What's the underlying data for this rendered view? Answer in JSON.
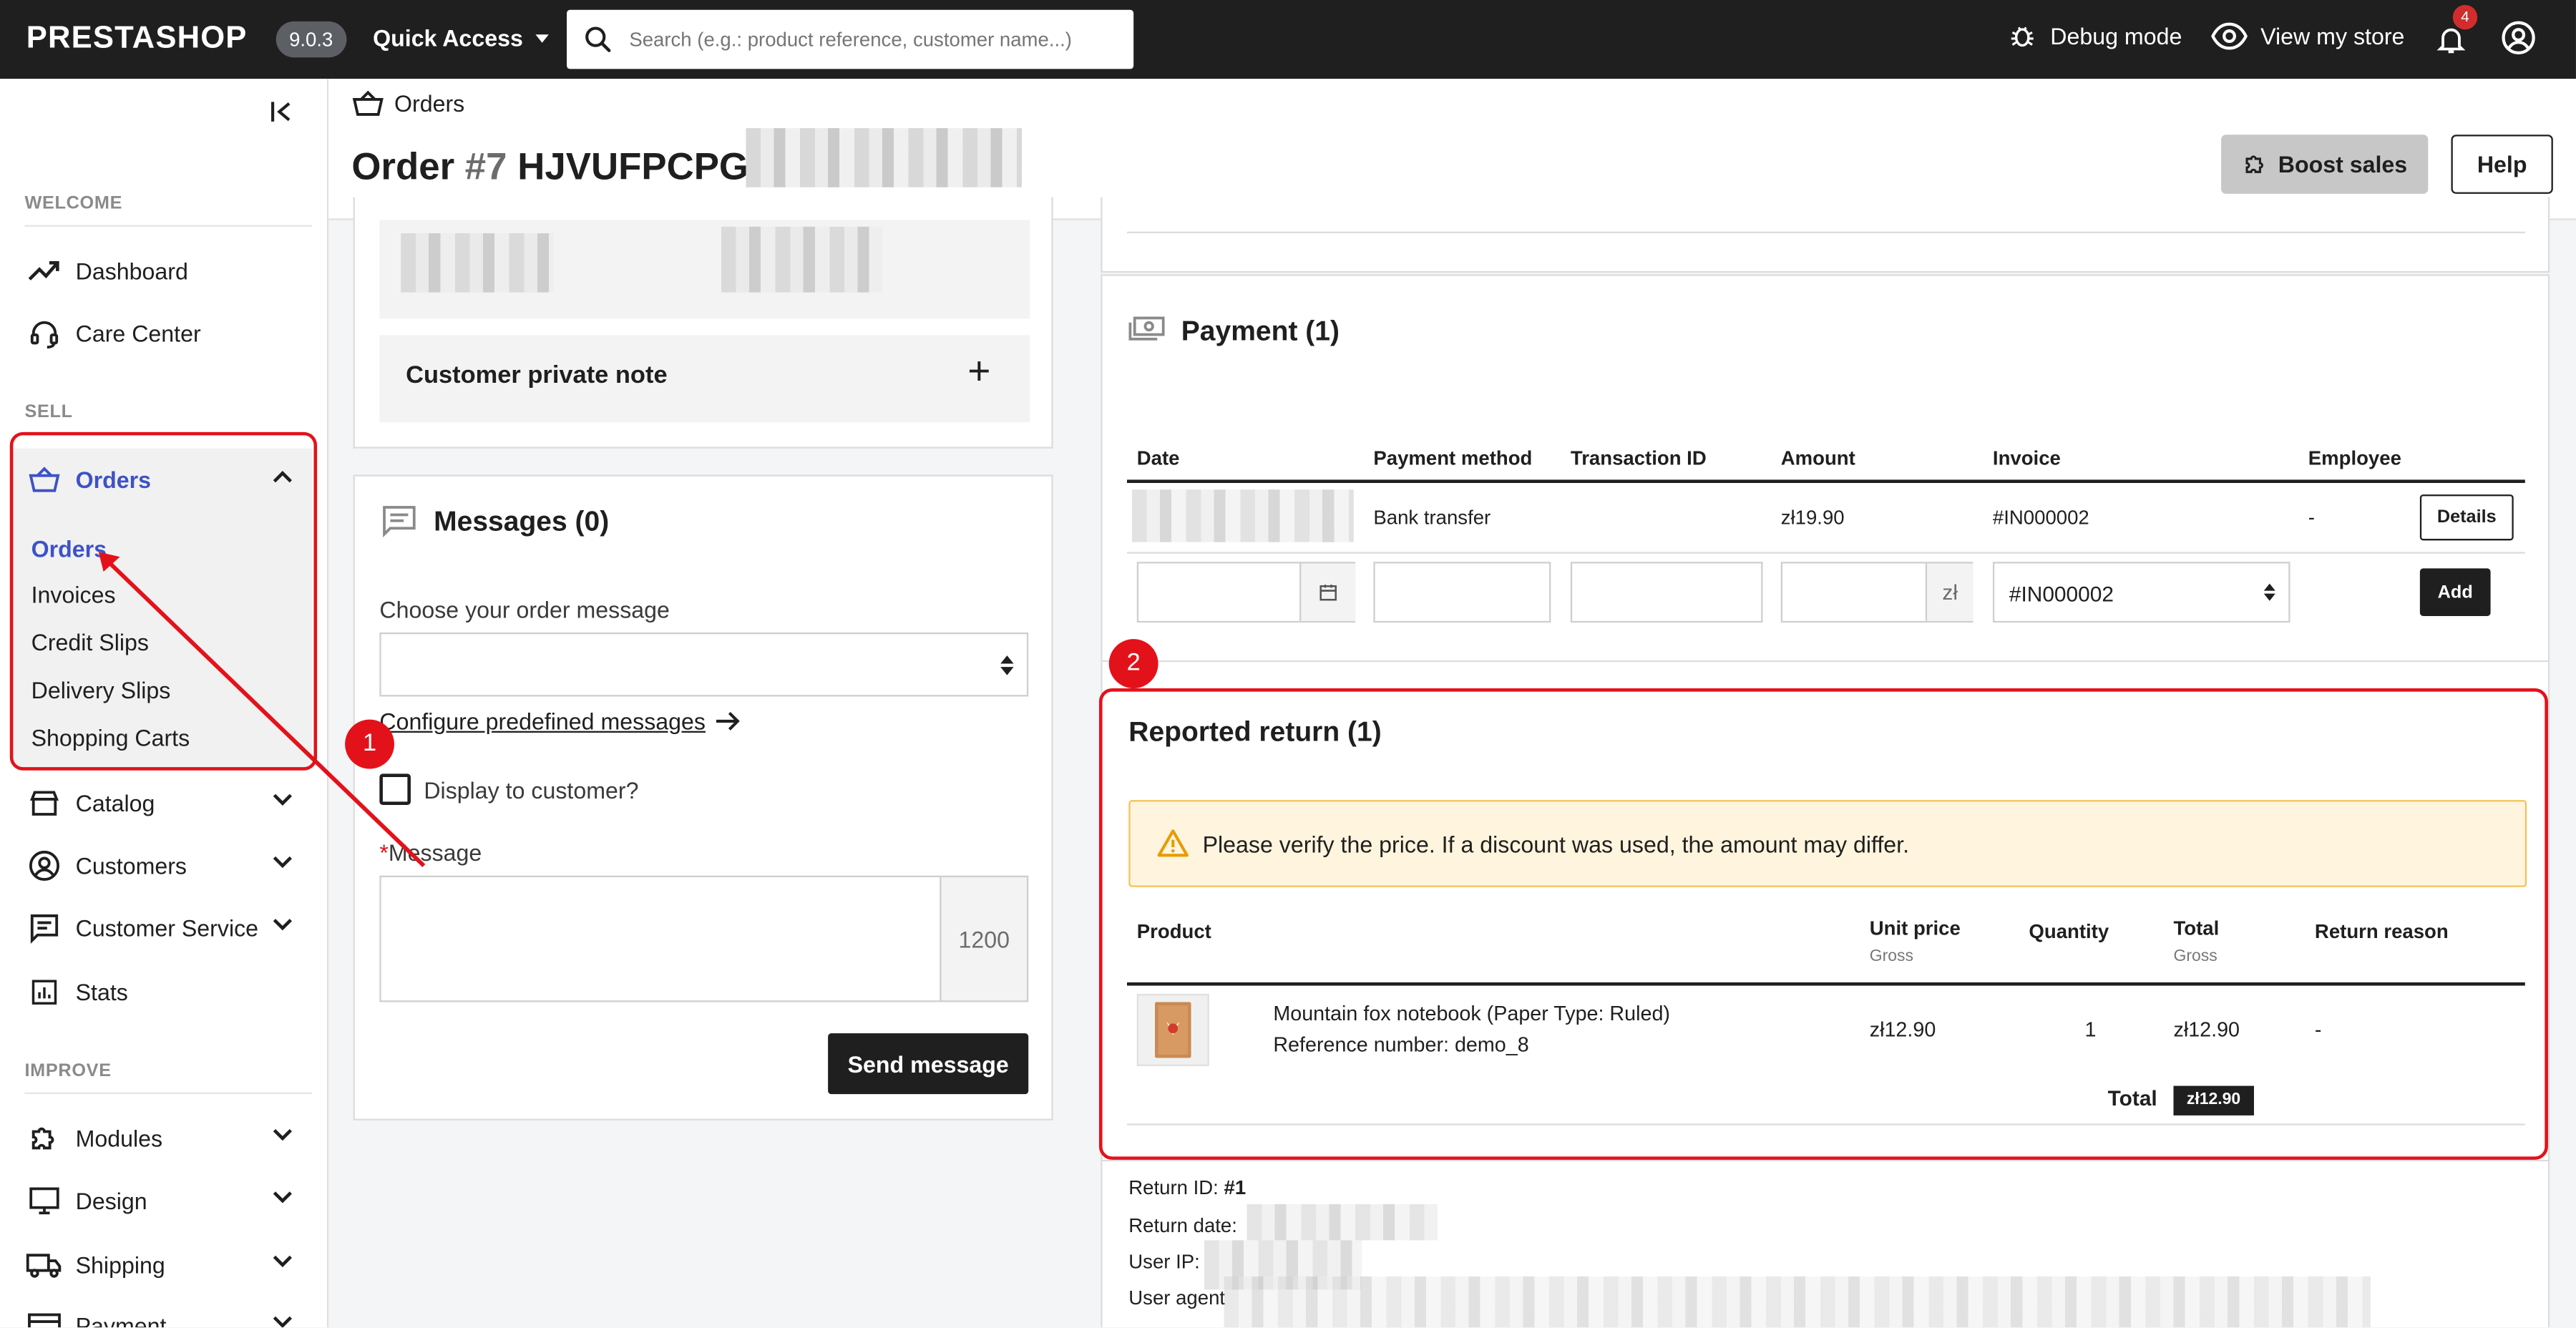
{
  "topbar": {
    "logo": "PRESTASHOP",
    "version": "9.0.3",
    "quick_access": "Quick Access",
    "search_placeholder": "Search (e.g.: product reference, customer name...)",
    "debug": "Debug mode",
    "view_store": "View my store",
    "notifications_count": "4"
  },
  "sidebar": {
    "section_welcome": "WELCOME",
    "section_sell": "SELL",
    "section_improve": "IMPROVE",
    "dashboard": "Dashboard",
    "care_center": "Care Center",
    "orders": "Orders",
    "orders_sub": [
      "Orders",
      "Invoices",
      "Credit Slips",
      "Delivery Slips",
      "Shopping Carts"
    ],
    "catalog": "Catalog",
    "customers": "Customers",
    "customer_service": "Customer Service",
    "stats": "Stats",
    "modules": "Modules",
    "design": "Design",
    "shipping": "Shipping",
    "payment": "Payment"
  },
  "header": {
    "breadcrumb": "Orders",
    "title_prefix": "Order ",
    "title_number": "#7",
    "title_ref": " HJVUFPCPG",
    "boost": "Boost sales",
    "help": "Help"
  },
  "private_note": {
    "title": "Customer private note",
    "plus": "+"
  },
  "messages": {
    "title": "Messages (0)",
    "choose_label": "Choose your order message",
    "configure_link": "Configure predefined messages",
    "display_to_customer": "Display to customer?",
    "required_star": "*",
    "message_label": "Message",
    "char_count": "1200",
    "send": "Send message"
  },
  "payment": {
    "title": "Payment (1)",
    "columns": [
      "Date",
      "Payment method",
      "Transaction ID",
      "Amount",
      "Invoice",
      "Employee"
    ],
    "row": {
      "method": "Bank transfer",
      "amount": "zł19.90",
      "invoice": "#IN000002",
      "employee": "-",
      "details": "Details"
    },
    "form": {
      "currency": "zł",
      "invoice_select": "#IN000002",
      "add": "Add"
    }
  },
  "reported_return": {
    "title": "Reported return (1)",
    "warning": "Please verify the price. If a discount was used, the amount may differ.",
    "columns": {
      "product": "Product",
      "unit_price": "Unit price",
      "unit_price_sub": "Gross",
      "quantity": "Quantity",
      "total": "Total",
      "total_sub": "Gross",
      "reason": "Return reason"
    },
    "row": {
      "name": "Mountain fox notebook (Paper Type: Ruled)",
      "reference": "Reference number: demo_8",
      "unit_price": "zł12.90",
      "quantity": "1",
      "total": "zł12.90",
      "reason": "-"
    },
    "total_label": "Total",
    "total_value": "zł12.90"
  },
  "return_info": {
    "return_id_label": "Return ID:",
    "return_id_value": "#1",
    "return_date_label": "Return date:",
    "user_ip_label": "User IP:",
    "user_agent_label": "User agent"
  },
  "annotations": {
    "badge1": "1",
    "badge2": "2"
  },
  "colors": {
    "accent": "#3d52c7",
    "annotation_red": "#e3121a",
    "dark": "#1f1f1f",
    "warning_bg": "#fff5de",
    "warning_border": "#f2c25b"
  }
}
